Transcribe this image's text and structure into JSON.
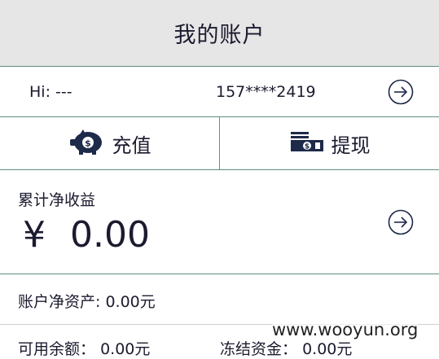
{
  "header": {
    "title": "我的账户"
  },
  "user": {
    "greeting": "Hi: ---",
    "phone": "157****2419"
  },
  "actions": {
    "recharge_label": "充值",
    "withdraw_label": "提现"
  },
  "earnings": {
    "label": "累计净收益",
    "currency": "¥",
    "amount": "0.00"
  },
  "net_assets": {
    "text": "账户净资产: 0.00元"
  },
  "balances": {
    "available_label": "可用余额：",
    "available_value": "0.00元",
    "frozen_label": "冻结资金：",
    "frozen_value": "0.00元"
  },
  "watermark": "www.wooyun.org",
  "icons": {
    "user_arrow": "chevron-right-circle-icon",
    "earnings_arrow": "chevron-right-circle-icon",
    "recharge": "piggy-bank-icon",
    "withdraw": "cash-icon"
  },
  "colors": {
    "header_bg": "#e6e6e6",
    "divider": "#5f8f80",
    "text": "#1b1b2f",
    "icon": "#1e2a4a"
  }
}
